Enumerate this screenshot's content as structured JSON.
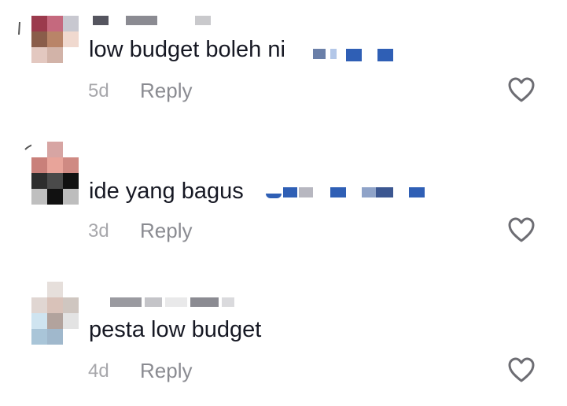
{
  "comments": [
    {
      "text": "low budget boleh ni",
      "time": "5d",
      "reply_label": "Reply",
      "avatar_colors": [
        "#9b3a4d",
        "#c5697e",
        "#c8c8d0",
        "#8a5d4a",
        "#b98468",
        "#f0d9cf",
        "#e3c8c0",
        "#d2b3a8",
        "#ffffff"
      ]
    },
    {
      "text": "ide yang bagus",
      "time": "3d",
      "reply_label": "Reply",
      "avatar_colors": [
        "#ffffff",
        "#d7a5a3",
        "#ffffff",
        "#c9807a",
        "#e8a49a",
        "#cf8a83",
        "#2d2d2d",
        "#4a4a4a",
        "#111111"
      ]
    },
    {
      "text": "pesta low budget",
      "time": "4d",
      "reply_label": "Reply",
      "avatar_colors": [
        "#ffffff",
        "#e6dfdb",
        "#ffffff",
        "#e0d6d2",
        "#d9c2b9",
        "#cfc6c0",
        "#cfe4f0",
        "#b2a39d",
        "#e3e3e3"
      ]
    }
  ],
  "icons": {
    "like": "heart-outline-icon",
    "avatar": "avatar-icon"
  },
  "colors": {
    "text": "#161823",
    "muted": "#a7a7ab",
    "reply": "#8a8b91",
    "emoji_blue": "#2f5fb5"
  }
}
